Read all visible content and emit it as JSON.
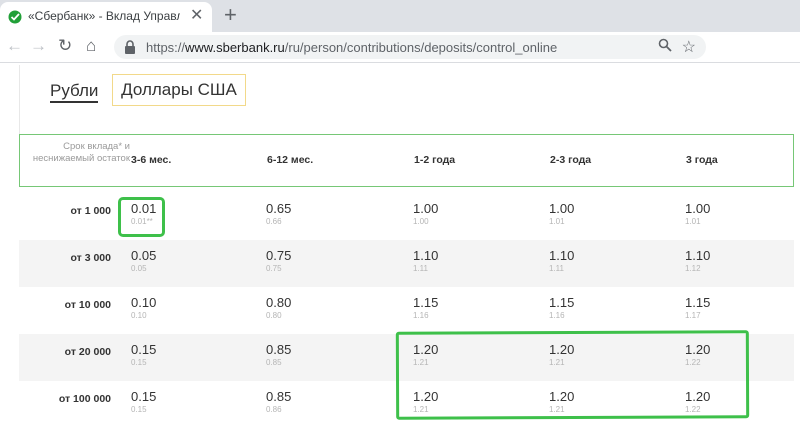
{
  "browser": {
    "tab_title": "«Сбербанк» - Вклад Управляй",
    "tab_close": "✕",
    "new_tab": "+",
    "url_scheme": "https://",
    "url_host": "www.sberbank.ru",
    "url_path": "/ru/person/contributions/deposits/control_online",
    "nav_back": "←",
    "nav_forward": "→",
    "nav_reload": "↻",
    "nav_home": "⌂",
    "zoom_icon": "🔍",
    "star_icon": "☆",
    "favicon_color": "#21a038"
  },
  "currency_tabs": {
    "rub": "Рубли",
    "usd": "Доллары США"
  },
  "table": {
    "header_first": "Срок вклада* и неснижаемый остаток",
    "columns": [
      "3-6 мес.",
      "6-12 мес.",
      "1-2 года",
      "2-3 года",
      "3 года"
    ],
    "rows": [
      {
        "label": "от 1 000",
        "rates": [
          "0.01",
          "0.65",
          "1.00",
          "1.00",
          "1.00"
        ],
        "subs": [
          "0.01**",
          "0.66",
          "1.00",
          "1.01",
          "1.01"
        ]
      },
      {
        "label": "от 3 000",
        "rates": [
          "0.05",
          "0.75",
          "1.10",
          "1.10",
          "1.10"
        ],
        "subs": [
          "0.05",
          "0.75",
          "1.11",
          "1.11",
          "1.12"
        ]
      },
      {
        "label": "от 10 000",
        "rates": [
          "0.10",
          "0.80",
          "1.15",
          "1.15",
          "1.15"
        ],
        "subs": [
          "0.10",
          "0.80",
          "1.16",
          "1.16",
          "1.17"
        ]
      },
      {
        "label": "от 20 000",
        "rates": [
          "0.15",
          "0.85",
          "1.20",
          "1.20",
          "1.20"
        ],
        "subs": [
          "0.15",
          "0.85",
          "1.21",
          "1.21",
          "1.22"
        ]
      },
      {
        "label": "от 100 000",
        "rates": [
          "0.15",
          "0.85",
          "1.20",
          "1.20",
          "1.20"
        ],
        "subs": [
          "0.15",
          "0.86",
          "1.21",
          "1.21",
          "1.22"
        ]
      }
    ]
  },
  "highlight_color": "#3ec04a"
}
